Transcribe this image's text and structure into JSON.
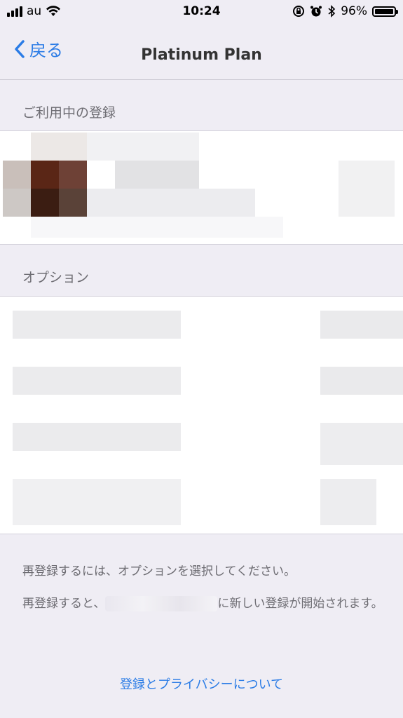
{
  "status_bar": {
    "carrier": "au",
    "time": "10:24",
    "battery_percent": "96%",
    "icons": [
      "signal-icon",
      "wifi-icon",
      "orientation-lock-icon",
      "alarm-icon",
      "bluetooth-icon",
      "battery-icon"
    ]
  },
  "nav": {
    "back_label": "戻る",
    "title": "Platinum Plan"
  },
  "sections": {
    "current_subscription_header": "ご利用中の登録",
    "options_header": "オプション"
  },
  "footer": {
    "line1": "再登録するには、オプションを選択してください。",
    "line2_prefix": "再登録すると、",
    "line2_suffix": "に新しい登録が開始されます。"
  },
  "privacy_link": "登録とプライバシーについて",
  "colors": {
    "accent": "#2b7ce6",
    "background": "#efedf4",
    "secondary_text": "#6e6d73"
  }
}
